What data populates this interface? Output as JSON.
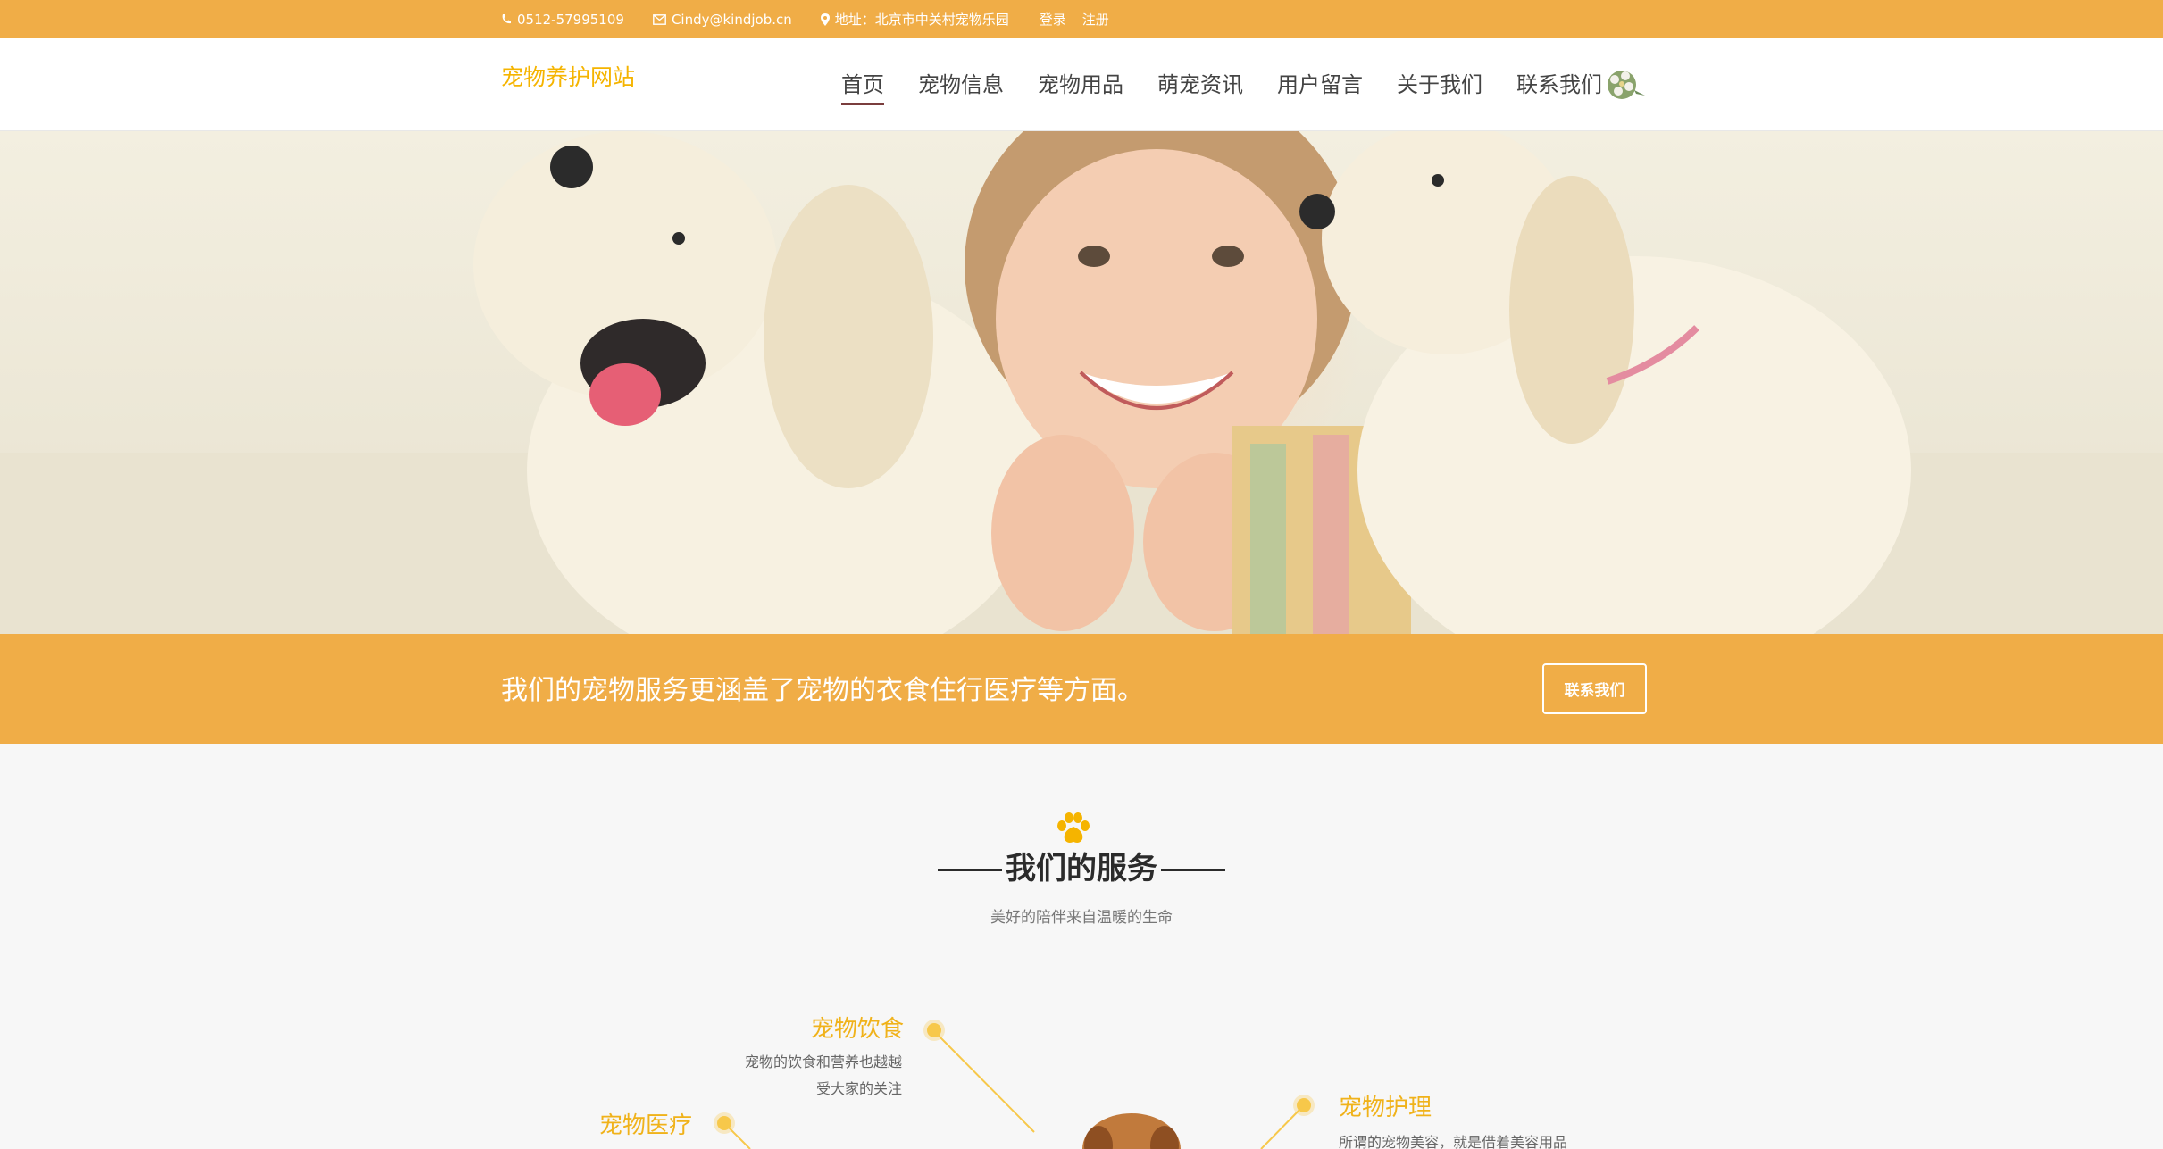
{
  "topbar": {
    "phone": "0512-57995109",
    "email": "Cindy@kindjob.cn",
    "address": "地址：北京市中关村宠物乐园",
    "login": "登录",
    "register": "注册"
  },
  "header": {
    "logo": "宠物养护网站",
    "nav": [
      "首页",
      "宠物信息",
      "宠物用品",
      "萌宠资讯",
      "用户留言",
      "关于我们",
      "联系我们"
    ],
    "active_index": 0
  },
  "banner": {
    "text": "我们的宠物服务更涵盖了宠物的衣食住行医疗等方面。",
    "button": "联系我们"
  },
  "services": {
    "title": "我们的服务",
    "subtitle": "美好的陪伴来自温暖的生命",
    "items": [
      {
        "title": "宠物饮食",
        "desc": [
          "宠物的饮食和营养也越越",
          "受大家的关注"
        ]
      },
      {
        "title": "宠物医疗",
        "desc": []
      },
      {
        "title": "宠物护理",
        "desc": [
          "所谓的宠物美容，就是借着美容用品"
        ]
      }
    ]
  },
  "colors": {
    "accent": "#f0ad47",
    "logo": "#f5b400",
    "service_title": "#f0b21a"
  }
}
